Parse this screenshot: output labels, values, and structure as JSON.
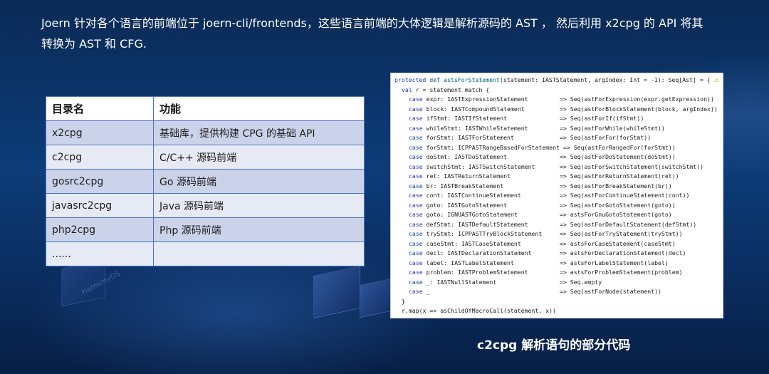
{
  "intro": {
    "line1": "Joern 针对各个语言的前端位于 joern-cli/frontends，这些语言前端的大体逻辑是解析源码的 AST ， 然后利用 x2cpg 的 API 将其",
    "line2": "转换为 AST 和 CFG."
  },
  "table": {
    "headers": [
      "目录名",
      "功能"
    ],
    "rows": [
      [
        "x2cpg",
        "基础库，提供构建 CPG 的基础 API"
      ],
      [
        "c2cpg",
        "C/C++ 源码前端"
      ],
      [
        "gosrc2cpg",
        "Go 源码前端"
      ],
      [
        "javasrc2cpg",
        "Java 源码前端"
      ],
      [
        "php2cpg",
        "Php 源码前端"
      ],
      [
        "......",
        ""
      ]
    ]
  },
  "code": {
    "header": {
      "kw": "protected def",
      "fn": "astsForStatement",
      "rest": "(statement: IASTStatement, argIndex: Int = -1): Seq[Ast] = {"
    },
    "val_kw": "val",
    "val_rest": "r = statement match {",
    "case_kw": "case",
    "cases": [
      [
        "expr: IASTExpressionStatement",
        "=> Seq(astForExpression(expr.getExpression))"
      ],
      [
        "block: IASTCompoundStatement",
        "=> Seq(astForBlockStatement(block, argIndex))"
      ],
      [
        "ifStmt: IASTIfStatement",
        "=> Seq(astForIf(ifStmt))"
      ],
      [
        "whileStmt: IASTWhileStatement",
        "=> Seq(astForWhile(whileStmt))"
      ],
      [
        "forStmt: IASTForStatement",
        "=> Seq(astForFor(forStmt))"
      ],
      [
        "forStmt: ICPPASTRangeBasedForStatement",
        "=> Seq(astForRangedFor(forStmt))"
      ],
      [
        "doStmt: IASTDoStatement",
        "=> Seq(astForDoStatement(doStmt))"
      ],
      [
        "switchStmt: IASTSwitchStatement",
        "=> Seq(astForSwitchStatement(switchStmt))"
      ],
      [
        "ret: IASTReturnStatement",
        "=> Seq(astForReturnStatement(ret))"
      ],
      [
        "br: IASTBreakStatement",
        "=> Seq(astForBreakStatement(br))"
      ],
      [
        "cont: IASTContinueStatement",
        "=> Seq(astForContinueStatement(cont))"
      ],
      [
        "goto: IASTGotoStatement",
        "=> Seq(astForGotoStatement(goto))"
      ],
      [
        "goto: IGNUASTGotoStatement",
        "=> astsForGnuGotoStatement(goto)"
      ],
      [
        "defStmt: IASTDefaultStatement",
        "=> Seq(astForDefaultStatement(defStmt))"
      ],
      [
        "tryStmt: ICPPASTTryBlockStatement",
        "=> Seq(astForTryStatement(tryStmt))"
      ],
      [
        "caseStmt: IASTCaseStatement",
        "=> astsForCaseStatement(caseStmt)"
      ],
      [
        "decl: IASTDeclarationStatement",
        "=> astsForDeclarationStatement(decl)"
      ],
      [
        "label: IASTLabelStatement",
        "=> astsForLabelStatement(label)"
      ],
      [
        "problem: IASTProblemStatement",
        "=> astsForProblemStatement(problem)"
      ],
      [
        "_: IASTNullStatement",
        "=> Seq.empty"
      ],
      [
        "_",
        "=> Seq(astForNode(statement))"
      ]
    ],
    "close": "}",
    "map_line": "r.map(x => asChildOfMacroCall(statement, x))",
    "corner_mark": "⚠"
  },
  "caption": "c2cpg 解析语句的部分代码",
  "watermark": "HarmonyOS"
}
